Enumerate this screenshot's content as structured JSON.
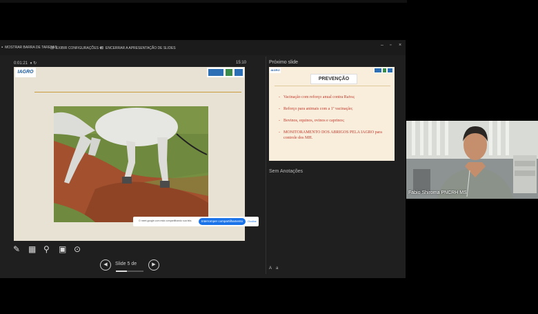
{
  "toolbar": {
    "items": [
      "MOSTRAR BARRA DE TAREFAS",
      "EXIBIR CONFIGURAÇÕES ▾",
      "ENCERRAR A APRESENTAÇÃO DE SLIDES"
    ],
    "window_controls": [
      "–",
      "▫",
      "×"
    ]
  },
  "presenter": {
    "timer": "0:01:21",
    "clock": "15:10",
    "slide_label": "Slide 5 de",
    "progress_fraction": 0.4
  },
  "current_slide": {
    "logo_text": "IAGRO"
  },
  "next_slide": {
    "label": "Próximo slide",
    "logo_text": "IAGRO",
    "title": "PREVENÇÃO",
    "bullets": [
      "Vacinação com reforço anual contra Raiva;",
      "Reforço para animais com a 1ª vacinação;",
      "Bovinos, equinos, ovinos e caprinos;",
      "MONITORAMENTO DOS ABRIGOS PELA IAGRO para controle dos MH."
    ]
  },
  "notes": {
    "text": "Sem Anotações"
  },
  "share_banner": {
    "message": "O meet.google.com está compartilhando sua tela.",
    "stop_label": "Interromper compartilhamento",
    "hide_label": "Ocultar"
  },
  "video": {
    "participant_name": "Fabio Shiroma PNCRH MS"
  },
  "icons": [
    "pen-icon",
    "slides-grid-icon",
    "zoom-icon",
    "pointer-icon",
    "more-icon",
    "prev-icon",
    "next-icon"
  ],
  "colors": {
    "iagro_blue": "#1b5a9e",
    "bullet_red": "#c0392b",
    "share_blue": "#1a73e8"
  }
}
